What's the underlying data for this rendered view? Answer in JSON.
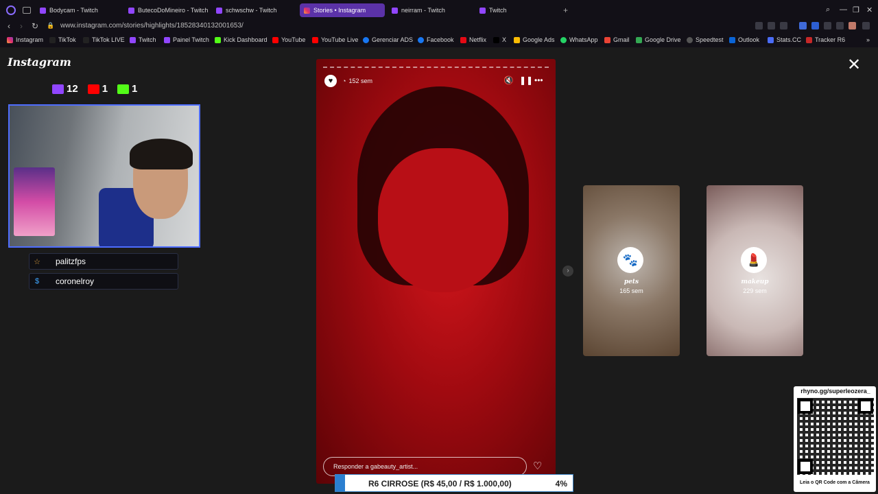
{
  "tabs": [
    {
      "label": "Bodycam - Twitch"
    },
    {
      "label": "ButecoDoMineiro - Twitch"
    },
    {
      "label": "schwschw - Twitch"
    },
    {
      "label": "Stories • Instagram"
    },
    {
      "label": "neirram - Twitch"
    },
    {
      "label": "Twitch"
    }
  ],
  "address": {
    "url": "www.instagram.com/stories/highlights/18528340132001653/"
  },
  "bookmarks": [
    {
      "label": "Instagram"
    },
    {
      "label": "TikTok"
    },
    {
      "label": "TikTok LIVE"
    },
    {
      "label": "Twitch"
    },
    {
      "label": "Painel Twitch"
    },
    {
      "label": "Kick Dashboard"
    },
    {
      "label": "YouTube"
    },
    {
      "label": "YouTube Live"
    },
    {
      "label": "Gerenciar ADS"
    },
    {
      "label": "Facebook"
    },
    {
      "label": "Netflix"
    },
    {
      "label": "X"
    },
    {
      "label": "Google Ads"
    },
    {
      "label": "WhatsApp"
    },
    {
      "label": "Gmail"
    },
    {
      "label": "Google Drive"
    },
    {
      "label": "Speedtest"
    },
    {
      "label": "Outlook"
    },
    {
      "label": "Stats.CC"
    },
    {
      "label": "Tracker R6"
    }
  ],
  "instagram": {
    "logo": "Instagram"
  },
  "viewers": {
    "twitch": "12",
    "youtube": "1",
    "kick": "1"
  },
  "chatters": [
    {
      "name": "palitzfps"
    },
    {
      "name": "coronelroy"
    }
  ],
  "story": {
    "age": "152 sem",
    "reply_placeholder": "Responder a gabeauty_artist..."
  },
  "highlights": [
    {
      "title": "pets",
      "age": "165 sem"
    },
    {
      "title": "makeup",
      "age": "229 sem"
    }
  ],
  "qr": {
    "url": "rhyno.gg/superleozera_",
    "caption": "Leia o QR Code com a Câmera"
  },
  "goal": {
    "label": "R6 CIRROSE (R$ 45,00 / R$ 1.000,00)",
    "percent_label": "4%",
    "percent": 4
  },
  "colors": {
    "accent": "#5b32a8",
    "story_red": "#c8141b",
    "goal_blue": "#2b7fd0"
  }
}
